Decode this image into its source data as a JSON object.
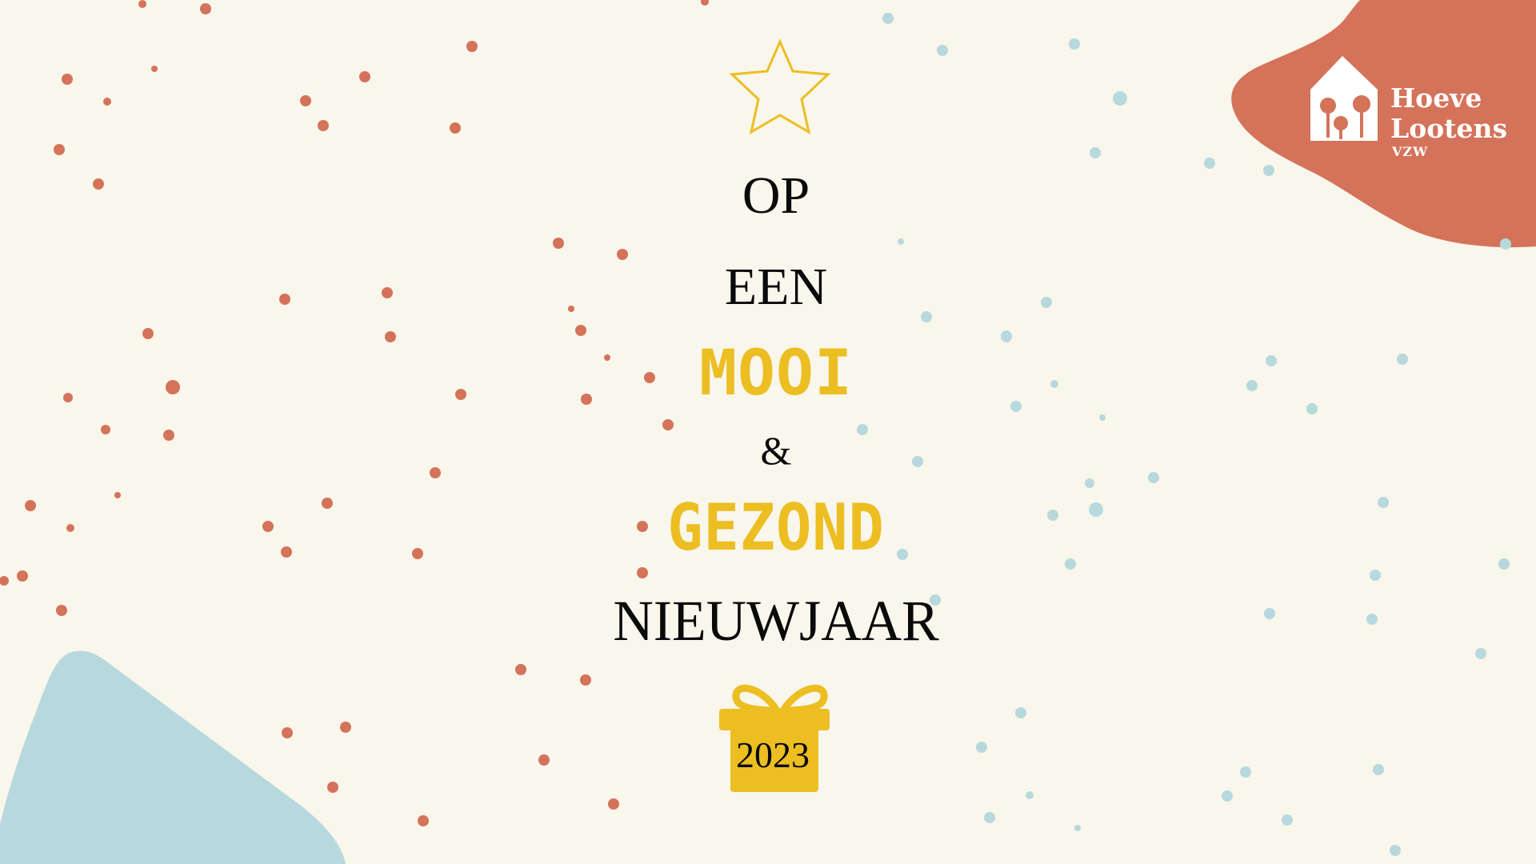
{
  "colors": {
    "background": "#f9f6ec",
    "coral": "#d4735a",
    "light_blue": "#b7d8dd",
    "yellow": "#ecbe22",
    "text_dark": "#0a0a0a",
    "logo_text": "#ffffff"
  },
  "decorations": {
    "top_icon": "star-outline-icon",
    "bottom_icon": "gift-box-icon",
    "logo_icon": "house-with-trees-icon"
  },
  "greeting": {
    "line_1": "OP",
    "line_2": "EEN",
    "line_3": "MOOI",
    "line_4": "&",
    "line_5": "GEZOND",
    "line_6": "NIEUWJAAR",
    "year": "2023"
  },
  "logo": {
    "name_line_1": "Hoeve",
    "name_line_2": "Lootens",
    "suffix": "VZW"
  }
}
